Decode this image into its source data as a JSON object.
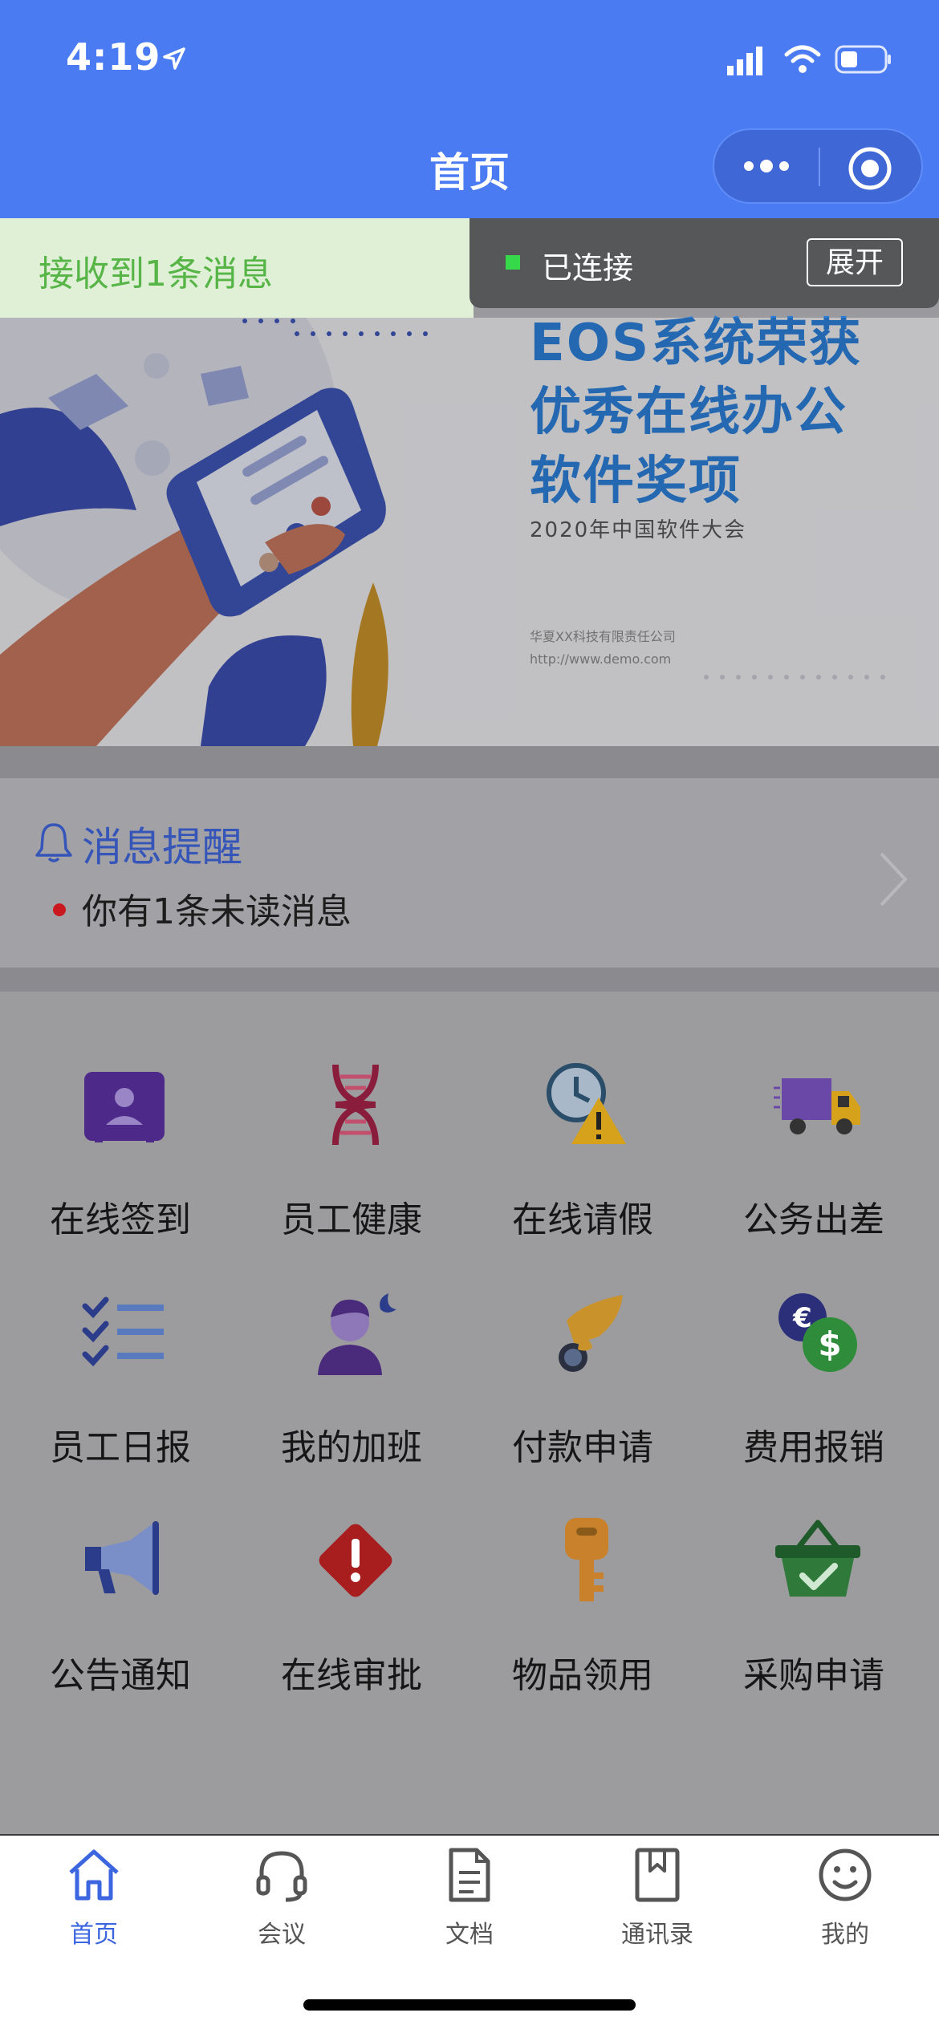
{
  "status_bar": {
    "time": "4:19"
  },
  "nav": {
    "title": "首页",
    "more_icon": "more-dots-icon",
    "close_icon": "target-circle-icon"
  },
  "toast": {
    "message": "接收到1条消息"
  },
  "connection": {
    "status": "已连接",
    "expand_label": "展开",
    "status_color": "#35d94a"
  },
  "banner": {
    "headline_lines": [
      "EOS系统荣获",
      "优秀在线办公",
      "软件奖项"
    ],
    "subtitle": "2020年中国软件大会",
    "company": "华夏XX科技有限责任公司",
    "url": "http://www.demo.com"
  },
  "message_card": {
    "title": "消息提醒",
    "content": "你有1条未读消息",
    "accent": "#3555b8"
  },
  "grid": {
    "items": [
      {
        "label": "在线签到",
        "icon": "id-card-icon"
      },
      {
        "label": "员工健康",
        "icon": "dna-icon"
      },
      {
        "label": "在线请假",
        "icon": "clock-warning-icon"
      },
      {
        "label": "公务出差",
        "icon": "delivery-truck-icon"
      },
      {
        "label": "员工日报",
        "icon": "checklist-icon"
      },
      {
        "label": "我的加班",
        "icon": "person-moon-icon"
      },
      {
        "label": "付款申请",
        "icon": "hand-coin-icon"
      },
      {
        "label": "费用报销",
        "icon": "currency-coins-icon"
      },
      {
        "label": "公告通知",
        "icon": "megaphone-icon"
      },
      {
        "label": "在线审批",
        "icon": "warning-diamond-icon"
      },
      {
        "label": "物品领用",
        "icon": "key-icon"
      },
      {
        "label": "采购申请",
        "icon": "basket-icon"
      }
    ]
  },
  "tabbar": {
    "items": [
      {
        "label": "首页",
        "icon": "home-icon",
        "active": true
      },
      {
        "label": "会议",
        "icon": "headset-icon"
      },
      {
        "label": "文档",
        "icon": "document-icon"
      },
      {
        "label": "通讯录",
        "icon": "bookmark-book-icon"
      },
      {
        "label": "我的",
        "icon": "smiley-icon"
      }
    ],
    "active_color": "#3b66e0"
  }
}
